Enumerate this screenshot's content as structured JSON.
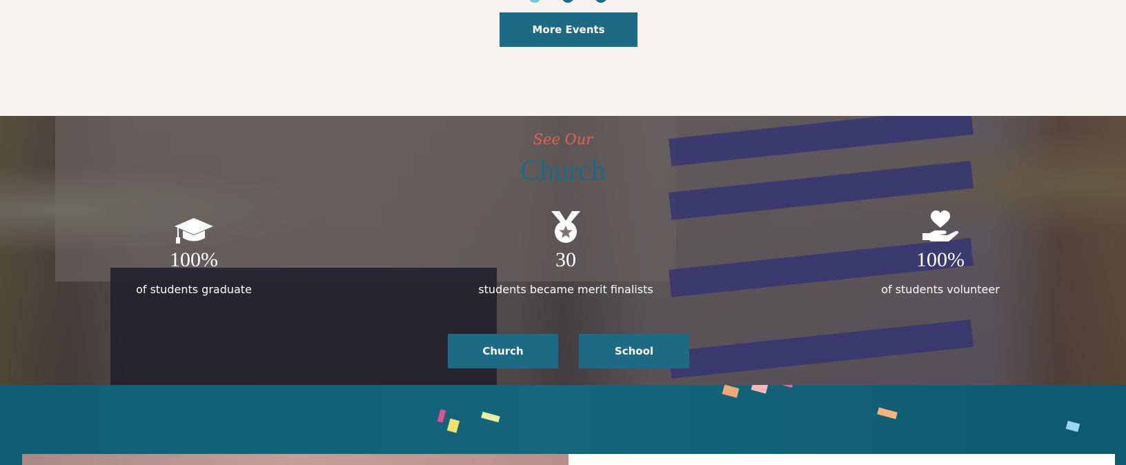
{
  "events_section": {
    "more_events_label": "More Events"
  },
  "stats_section": {
    "eyebrow": "See Our",
    "heading": "Church",
    "stats": [
      {
        "icon": "graduation-cap-icon",
        "value": "100%",
        "label": "of students graduate"
      },
      {
        "icon": "medal-icon",
        "value": "30",
        "label": "students became merit finalists"
      },
      {
        "icon": "heart-in-hand-icon",
        "value": "100%",
        "label": "of students volunteer"
      }
    ],
    "buttons": {
      "church_label": "Church",
      "school_label": "School"
    }
  },
  "colors": {
    "primary": "#1d6a85",
    "accent": "#e2644e",
    "background": "#f6f3ef",
    "teal_band": "#14667c"
  }
}
